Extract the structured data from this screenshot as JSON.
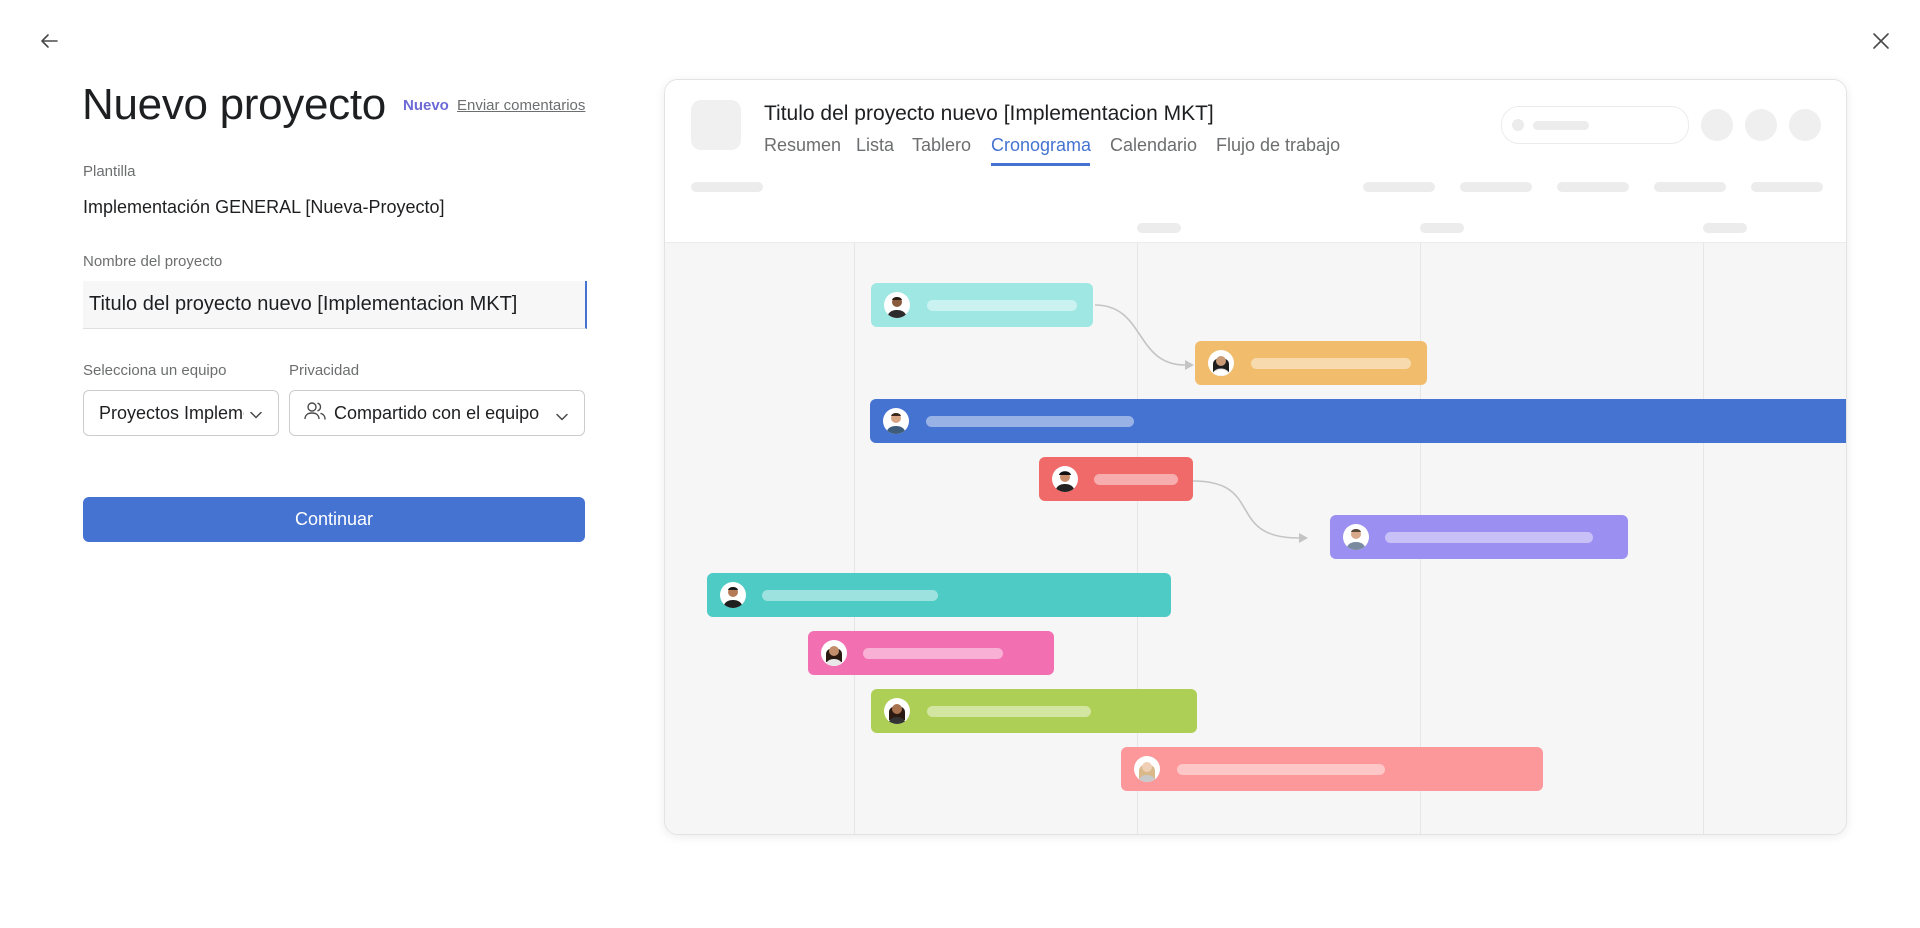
{
  "header": {
    "title": "Nuevo proyecto",
    "badge_new": "Nuevo",
    "feedback_link": "Enviar comentarios"
  },
  "form": {
    "template_label": "Plantilla",
    "template_value": "Implementación GENERAL [Nueva-Proyecto]",
    "name_label": "Nombre del proyecto",
    "name_value": "Titulo del proyecto nuevo [Implementacion MKT]",
    "team_label": "Selecciona un equipo",
    "team_value": "Proyectos Implementación",
    "privacy_label": "Privacidad",
    "privacy_value": "Compartido con el equipo",
    "continue_label": "Continuar"
  },
  "preview": {
    "project_title": "Titulo del proyecto nuevo [Implementacion MKT]",
    "tabs": [
      "Resumen",
      "Lista",
      "Tablero",
      "Cronograma",
      "Calendario",
      "Flujo de trabajo"
    ],
    "active_tab": "Cronograma",
    "accent_color": "#4573d2",
    "task_colors": [
      "#9ee7e3",
      "#f1bd6c",
      "#4573d2",
      "#f06a6a",
      "#9b8ff1",
      "#4ecbc4",
      "#f26fb2",
      "#aecf55",
      "#fc979a"
    ]
  },
  "icons": {
    "back": "arrow-left-icon",
    "close": "close-icon",
    "team_dropdown": "chevron-down-icon",
    "privacy": "people-icon"
  }
}
